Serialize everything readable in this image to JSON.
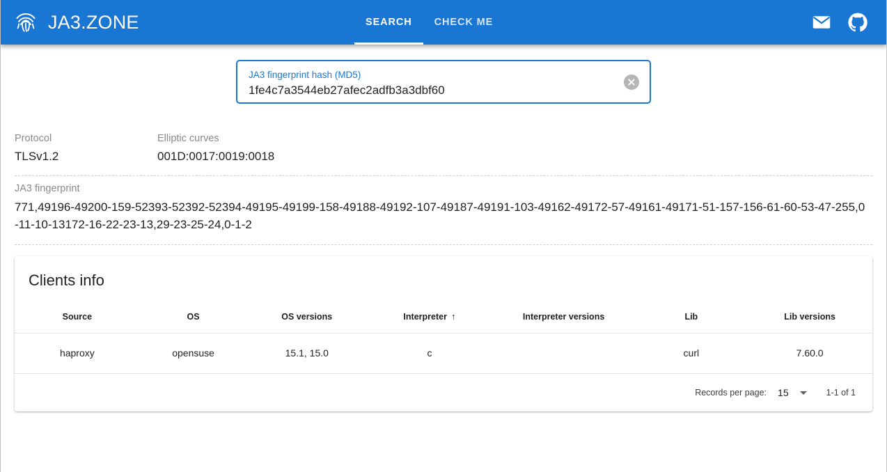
{
  "header": {
    "brand_title": "JA3.ZONE",
    "brand_icon": "fingerprint-icon",
    "tabs": [
      {
        "label": "SEARCH",
        "active": true
      },
      {
        "label": "CHECK ME",
        "active": false
      }
    ],
    "actions": [
      {
        "icon": "mail-icon"
      },
      {
        "icon": "github-icon"
      }
    ],
    "background_color": "#1976d2"
  },
  "search": {
    "label": "JA3 fingerprint hash (MD5)",
    "value": "1fe4c7a3544eb27afec2adfb3a3dbf60",
    "placeholder": "JA3 fingerprint hash (MD5)",
    "clear_icon": "clear-circle-icon",
    "accent_color": "#1976d2"
  },
  "details": {
    "protocol_label": "Protocol",
    "protocol_value": "TLSv1.2",
    "curves_label": "Elliptic curves",
    "curves_value": "001D:0017:0019:0018",
    "fingerprint_label": "JA3 fingerprint",
    "fingerprint_value": "771,49196-49200-159-52393-52392-52394-49195-49199-158-49188-49192-107-49187-49191-103-49162-49172-57-49161-49171-51-157-156-61-60-53-47-255,0-11-10-13172-16-22-23-13,29-23-25-24,0-1-2"
  },
  "clients": {
    "title": "Clients info",
    "columns": [
      {
        "key": "source",
        "label": "Source",
        "sorted": false
      },
      {
        "key": "os",
        "label": "OS",
        "sorted": false
      },
      {
        "key": "os_versions",
        "label": "OS versions",
        "sorted": false
      },
      {
        "key": "interpreter",
        "label": "Interpreter",
        "sorted": true,
        "sort_direction": "asc",
        "sort_icon": "arrow-up-icon"
      },
      {
        "key": "interpreter_versions",
        "label": "Interpreter versions",
        "sorted": false
      },
      {
        "key": "lib",
        "label": "Lib",
        "sorted": false
      },
      {
        "key": "lib_versions",
        "label": "Lib versions",
        "sorted": false
      }
    ],
    "rows": [
      {
        "source": "haproxy",
        "os": "opensuse",
        "os_versions": "15.1, 15.0",
        "interpreter": "c",
        "interpreter_versions": "",
        "lib": "curl",
        "lib_versions": "7.60.0"
      }
    ],
    "paginator": {
      "records_label": "Records per page:",
      "page_size": "15",
      "caret_icon": "chevron-down-icon",
      "range_label": "1-1 of 1"
    }
  }
}
